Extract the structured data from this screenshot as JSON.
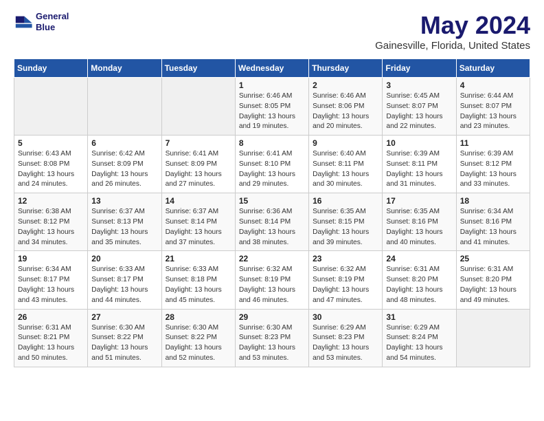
{
  "header": {
    "logo_line1": "General",
    "logo_line2": "Blue",
    "title": "May 2024",
    "subtitle": "Gainesville, Florida, United States"
  },
  "calendar": {
    "days_of_week": [
      "Sunday",
      "Monday",
      "Tuesday",
      "Wednesday",
      "Thursday",
      "Friday",
      "Saturday"
    ],
    "weeks": [
      [
        {
          "num": "",
          "info": ""
        },
        {
          "num": "",
          "info": ""
        },
        {
          "num": "",
          "info": ""
        },
        {
          "num": "1",
          "info": "Sunrise: 6:46 AM\nSunset: 8:05 PM\nDaylight: 13 hours\nand 19 minutes."
        },
        {
          "num": "2",
          "info": "Sunrise: 6:46 AM\nSunset: 8:06 PM\nDaylight: 13 hours\nand 20 minutes."
        },
        {
          "num": "3",
          "info": "Sunrise: 6:45 AM\nSunset: 8:07 PM\nDaylight: 13 hours\nand 22 minutes."
        },
        {
          "num": "4",
          "info": "Sunrise: 6:44 AM\nSunset: 8:07 PM\nDaylight: 13 hours\nand 23 minutes."
        }
      ],
      [
        {
          "num": "5",
          "info": "Sunrise: 6:43 AM\nSunset: 8:08 PM\nDaylight: 13 hours\nand 24 minutes."
        },
        {
          "num": "6",
          "info": "Sunrise: 6:42 AM\nSunset: 8:09 PM\nDaylight: 13 hours\nand 26 minutes."
        },
        {
          "num": "7",
          "info": "Sunrise: 6:41 AM\nSunset: 8:09 PM\nDaylight: 13 hours\nand 27 minutes."
        },
        {
          "num": "8",
          "info": "Sunrise: 6:41 AM\nSunset: 8:10 PM\nDaylight: 13 hours\nand 29 minutes."
        },
        {
          "num": "9",
          "info": "Sunrise: 6:40 AM\nSunset: 8:11 PM\nDaylight: 13 hours\nand 30 minutes."
        },
        {
          "num": "10",
          "info": "Sunrise: 6:39 AM\nSunset: 8:11 PM\nDaylight: 13 hours\nand 31 minutes."
        },
        {
          "num": "11",
          "info": "Sunrise: 6:39 AM\nSunset: 8:12 PM\nDaylight: 13 hours\nand 33 minutes."
        }
      ],
      [
        {
          "num": "12",
          "info": "Sunrise: 6:38 AM\nSunset: 8:12 PM\nDaylight: 13 hours\nand 34 minutes."
        },
        {
          "num": "13",
          "info": "Sunrise: 6:37 AM\nSunset: 8:13 PM\nDaylight: 13 hours\nand 35 minutes."
        },
        {
          "num": "14",
          "info": "Sunrise: 6:37 AM\nSunset: 8:14 PM\nDaylight: 13 hours\nand 37 minutes."
        },
        {
          "num": "15",
          "info": "Sunrise: 6:36 AM\nSunset: 8:14 PM\nDaylight: 13 hours\nand 38 minutes."
        },
        {
          "num": "16",
          "info": "Sunrise: 6:35 AM\nSunset: 8:15 PM\nDaylight: 13 hours\nand 39 minutes."
        },
        {
          "num": "17",
          "info": "Sunrise: 6:35 AM\nSunset: 8:16 PM\nDaylight: 13 hours\nand 40 minutes."
        },
        {
          "num": "18",
          "info": "Sunrise: 6:34 AM\nSunset: 8:16 PM\nDaylight: 13 hours\nand 41 minutes."
        }
      ],
      [
        {
          "num": "19",
          "info": "Sunrise: 6:34 AM\nSunset: 8:17 PM\nDaylight: 13 hours\nand 43 minutes."
        },
        {
          "num": "20",
          "info": "Sunrise: 6:33 AM\nSunset: 8:17 PM\nDaylight: 13 hours\nand 44 minutes."
        },
        {
          "num": "21",
          "info": "Sunrise: 6:33 AM\nSunset: 8:18 PM\nDaylight: 13 hours\nand 45 minutes."
        },
        {
          "num": "22",
          "info": "Sunrise: 6:32 AM\nSunset: 8:19 PM\nDaylight: 13 hours\nand 46 minutes."
        },
        {
          "num": "23",
          "info": "Sunrise: 6:32 AM\nSunset: 8:19 PM\nDaylight: 13 hours\nand 47 minutes."
        },
        {
          "num": "24",
          "info": "Sunrise: 6:31 AM\nSunset: 8:20 PM\nDaylight: 13 hours\nand 48 minutes."
        },
        {
          "num": "25",
          "info": "Sunrise: 6:31 AM\nSunset: 8:20 PM\nDaylight: 13 hours\nand 49 minutes."
        }
      ],
      [
        {
          "num": "26",
          "info": "Sunrise: 6:31 AM\nSunset: 8:21 PM\nDaylight: 13 hours\nand 50 minutes."
        },
        {
          "num": "27",
          "info": "Sunrise: 6:30 AM\nSunset: 8:22 PM\nDaylight: 13 hours\nand 51 minutes."
        },
        {
          "num": "28",
          "info": "Sunrise: 6:30 AM\nSunset: 8:22 PM\nDaylight: 13 hours\nand 52 minutes."
        },
        {
          "num": "29",
          "info": "Sunrise: 6:30 AM\nSunset: 8:23 PM\nDaylight: 13 hours\nand 53 minutes."
        },
        {
          "num": "30",
          "info": "Sunrise: 6:29 AM\nSunset: 8:23 PM\nDaylight: 13 hours\nand 53 minutes."
        },
        {
          "num": "31",
          "info": "Sunrise: 6:29 AM\nSunset: 8:24 PM\nDaylight: 13 hours\nand 54 minutes."
        },
        {
          "num": "",
          "info": ""
        }
      ]
    ]
  }
}
